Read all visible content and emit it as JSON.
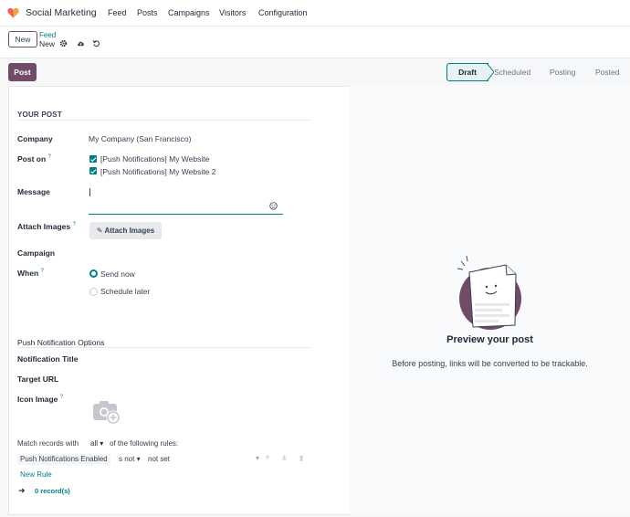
{
  "navbar": {
    "app_name": "Social Marketing",
    "menu": [
      "Feed",
      "Posts",
      "Campaigns",
      "Visitors",
      "Configuration"
    ]
  },
  "control_panel": {
    "new_label": "New",
    "breadcrumb_parent": "Feed",
    "breadcrumb_current": "New"
  },
  "actions": {
    "post_label": "Post"
  },
  "statusbar": {
    "stages": [
      "Draft",
      "Scheduled",
      "Posting",
      "Posted"
    ],
    "active": "Draft"
  },
  "form": {
    "section_your_post": "YOUR POST",
    "company_label": "Company",
    "company_value": "My Company (San Francisco)",
    "post_on_label": "Post on",
    "post_on_options": [
      "[Push Notifications] My Website",
      "[Push Notifications] My Website 2"
    ],
    "message_label": "Message",
    "message_value": "",
    "attach_label": "Attach Images",
    "attach_button": "Attach Images",
    "campaign_label": "Campaign",
    "when_label": "When",
    "when_options": [
      "Send now",
      "Schedule later"
    ],
    "when_selected": "Send now",
    "push_section": "Push Notification Options",
    "notification_title_label": "Notification Title",
    "target_url_label": "Target URL",
    "icon_image_label": "Icon Image",
    "match_prefix": "Match records with",
    "match_mode": "all",
    "match_suffix": "of the following rules:",
    "rule_field": "Push Notifications Enabled",
    "rule_operator": "s not",
    "rule_value": "not set",
    "new_rule": "New Rule",
    "record_count": "0 record(s)",
    "help_mark": "?"
  },
  "preview": {
    "title": "Preview your post",
    "subtitle": "Before posting, links will be converted to be trackable."
  },
  "colors": {
    "brand": "#714b67",
    "accent": "#017e84"
  }
}
